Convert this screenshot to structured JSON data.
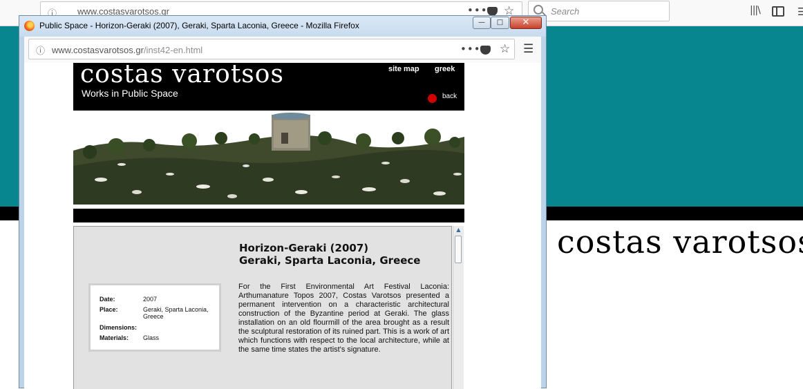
{
  "background": {
    "url": "www.costasvarotsos.gr",
    "search_placeholder": "Search",
    "logo": "costas varotsos",
    "colors": {
      "teal": "#08868f",
      "black": "#000000"
    }
  },
  "popup": {
    "title": "Public Space - Horizon-Geraki (2007), Geraki, Sparta Laconia, Greece - Mozilla Firefox",
    "url_host": "www.costasvarotsos.gr",
    "url_path": "/inst42-en.html",
    "buttons": {
      "minimize": "—",
      "maximize": "□",
      "close": "✕"
    }
  },
  "site": {
    "logo": "costas varotsos",
    "subtitle": "Works in Public Space",
    "nav": {
      "site_map": "site map",
      "greek": "greek",
      "back": "back"
    }
  },
  "work": {
    "title_line1": "Horizon-Geraki (2007)",
    "title_line2": "Geraki, Sparta Laconia, Greece",
    "description": "For the First Environmental Art Festival Laconia: Arthumanature Topos 2007, Costas Varotsos presented a permanent intervention on a characteristic architectural construction of the Byzantine period at Geraki. The glass installation on an old flourmill of the area brought as a result the sculptural restoration of its ruined part. This is a work of art which functions with respect to the local architecture, while at the same time states the artist's signature.",
    "details": [
      {
        "label": "Date:",
        "value": "2007"
      },
      {
        "label": "Place:",
        "value": "Geraki, Sparta Laconia, Greece"
      },
      {
        "label": "Dimensions:",
        "value": ""
      },
      {
        "label": "Materials:",
        "value": "Glass"
      }
    ]
  },
  "icons": [
    "info-icon",
    "more-icon",
    "pocket-icon",
    "star-icon",
    "menu-icon",
    "firefox-icon",
    "library-icon",
    "sidebar-icon",
    "search-icon"
  ]
}
